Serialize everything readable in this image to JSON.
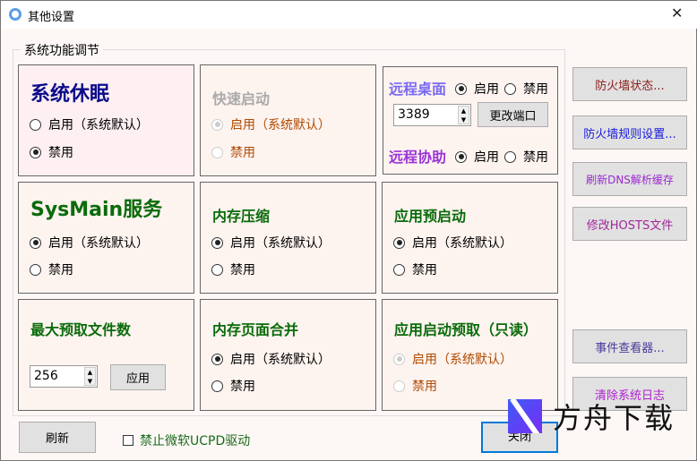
{
  "window": {
    "title": "其他设置",
    "close": "✕"
  },
  "group_label": "系统功能调节",
  "panels": {
    "sleep": {
      "title": "系统休眠",
      "opt1": "启用（系统默认）",
      "opt2": "禁用"
    },
    "fastboot": {
      "title": "快速启动",
      "opt1": "启用（系统默认）",
      "opt2": "禁用"
    },
    "remote": {
      "desktop": "远程桌面",
      "assist": "远程协助",
      "enable": "启用",
      "disable": "禁用",
      "port": "3389",
      "change_port": "更改端口"
    },
    "sysmain": {
      "title": "SysMain服务",
      "opt1": "启用（系统默认）",
      "opt2": "禁用"
    },
    "memcompress": {
      "title": "内存压缩",
      "opt1": "启用（系统默认）",
      "opt2": "禁用"
    },
    "prelaunch": {
      "title": "应用预启动",
      "opt1": "启用（系统默认）",
      "opt2": "禁用"
    },
    "prefetch": {
      "title": "最大预取文件数",
      "value": "256",
      "apply": "应用"
    },
    "pagecombine": {
      "title": "内存页面合并",
      "opt1": "启用（系统默认）",
      "opt2": "禁用"
    },
    "appprefetch": {
      "title": "应用启动预取（只读）",
      "opt1": "启用（系统默认）",
      "opt2": "禁用"
    }
  },
  "side_buttons": [
    "防火墙状态...",
    "防火墙规则设置...",
    "刷新DNS解析缓存",
    "修改HOSTS文件",
    "事件查看器...",
    "清除系统日志"
  ],
  "bottom": {
    "refresh": "刷新",
    "ucpd": "禁止微软UCPD驱动",
    "close": "关闭"
  },
  "watermark": "方舟下载"
}
